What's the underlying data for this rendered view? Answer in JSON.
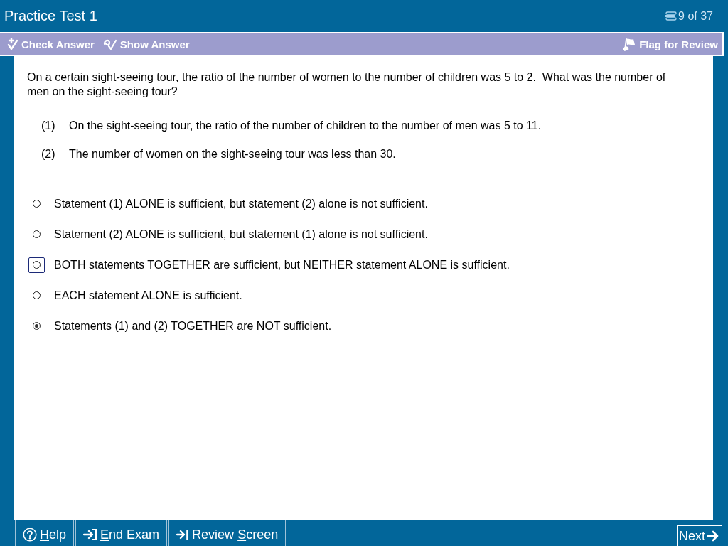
{
  "window": {
    "title": "Practice Test 1",
    "progress": "9 of 37"
  },
  "toolbar": {
    "left": [
      {
        "kind": "check",
        "before": "Chec",
        "key": "k",
        "after": " Answer"
      },
      {
        "kind": "show",
        "before": "Sh",
        "key": "o",
        "after": "w Answer"
      }
    ],
    "right": [
      {
        "kind": "flag",
        "key": "F",
        "after": "lag for Review"
      }
    ]
  },
  "question": {
    "stem": "On a certain sight-seeing tour, the ratio of the number of women to the number of children was 5 to 2.  What was the number of men on the sight-seeing tour?",
    "statements": [
      {
        "number": "(1)",
        "text": "On the sight-seeing tour, the ratio of the number of children to the number of men was 5 to 11."
      },
      {
        "number": "(2)",
        "text": "The number of women on the sight-seeing tour was less than 30."
      }
    ],
    "options": [
      {
        "text": "Statement (1) ALONE is sufficient, but statement (2) alone is not sufficient.",
        "selected": false,
        "focused": false
      },
      {
        "text": "Statement (2) ALONE is sufficient, but statement (1) alone is not sufficient.",
        "selected": false,
        "focused": false
      },
      {
        "text": "BOTH statements TOGETHER are sufficient, but NEITHER statement ALONE is sufficient.",
        "selected": false,
        "focused": true
      },
      {
        "text": "EACH statement ALONE is sufficient.",
        "selected": false,
        "focused": false
      },
      {
        "text": "Statements (1) and (2) TOGETHER are NOT sufficient.",
        "selected": true,
        "focused": false
      }
    ]
  },
  "footer": {
    "left": [
      {
        "kind": "help",
        "key": "H",
        "after": "elp"
      },
      {
        "kind": "end",
        "key": "E",
        "after": "nd Exam"
      },
      {
        "kind": "review",
        "before": "Review ",
        "key": "S",
        "after": "creen"
      }
    ],
    "right": [
      {
        "kind": "next",
        "key": "N",
        "after": "ext"
      }
    ]
  }
}
